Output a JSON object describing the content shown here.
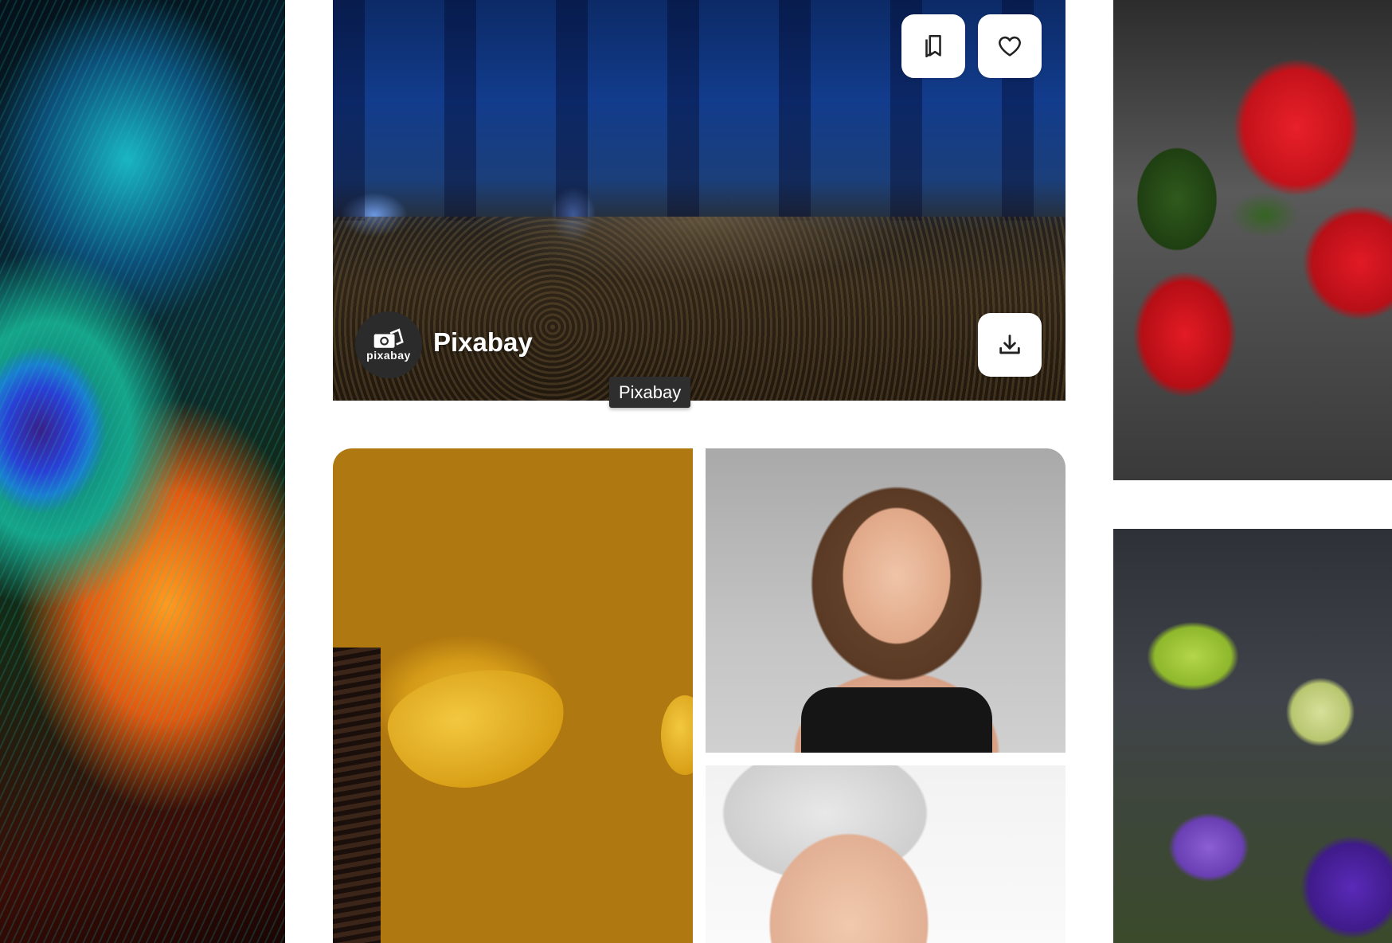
{
  "featured": {
    "author": "Pixabay",
    "avatar_text": "pixabay",
    "tooltip": "Pixabay",
    "buttons": {
      "collect_icon": "bookmark-collection-icon",
      "like_icon": "heart-icon",
      "download_icon": "download-icon"
    }
  },
  "colors": {
    "button_bg": "#ffffff",
    "tooltip_bg": "#2e2e2e",
    "page_bg": "#ffffff"
  },
  "photos": [
    {
      "name": "peacock-feather-photo"
    },
    {
      "name": "blue-butterflies-photo"
    },
    {
      "name": "hibiscus-photo"
    },
    {
      "name": "under-eye-patch-photo"
    },
    {
      "name": "makeup-brush-photo"
    },
    {
      "name": "towel-woman-photo"
    },
    {
      "name": "purple-flowers-photo"
    }
  ]
}
